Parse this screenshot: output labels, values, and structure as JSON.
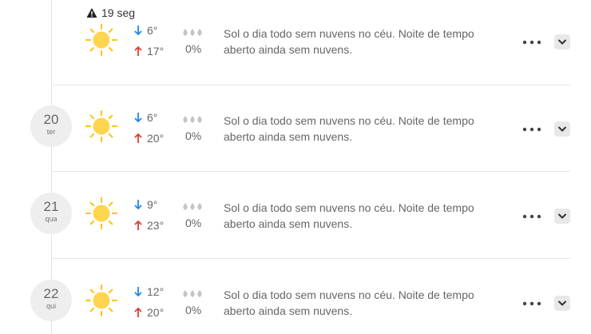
{
  "alert": {
    "icon": "warning-icon",
    "label": "19 seg"
  },
  "days": [
    {
      "date_num": "",
      "date_dow": "",
      "weather_icon": "sun-icon",
      "temp_low": "6°",
      "temp_high": "17°",
      "precip": "0%",
      "description": "Sol o dia todo sem nuvens no céu. Noite de tempo aberto ainda sem nuvens."
    },
    {
      "date_num": "20",
      "date_dow": "ter",
      "weather_icon": "sun-icon",
      "temp_low": "6°",
      "temp_high": "20°",
      "precip": "0%",
      "description": "Sol o dia todo sem nuvens no céu. Noite de tempo aberto ainda sem nuvens."
    },
    {
      "date_num": "21",
      "date_dow": "qua",
      "weather_icon": "sun-icon",
      "temp_low": "9°",
      "temp_high": "23°",
      "precip": "0%",
      "description": "Sol o dia todo sem nuvens no céu. Noite de tempo aberto ainda sem nuvens."
    },
    {
      "date_num": "22",
      "date_dow": "qui",
      "weather_icon": "sun-icon",
      "temp_low": "12°",
      "temp_high": "20°",
      "precip": "0%",
      "description": "Sol o dia todo sem nuvens no céu. Noite de tempo aberto ainda sem nuvens."
    }
  ],
  "colors": {
    "arrow_down": "#1e88e5",
    "arrow_up": "#e53935",
    "sun": "#ffd54f",
    "sun_rays": "#ffc107"
  }
}
